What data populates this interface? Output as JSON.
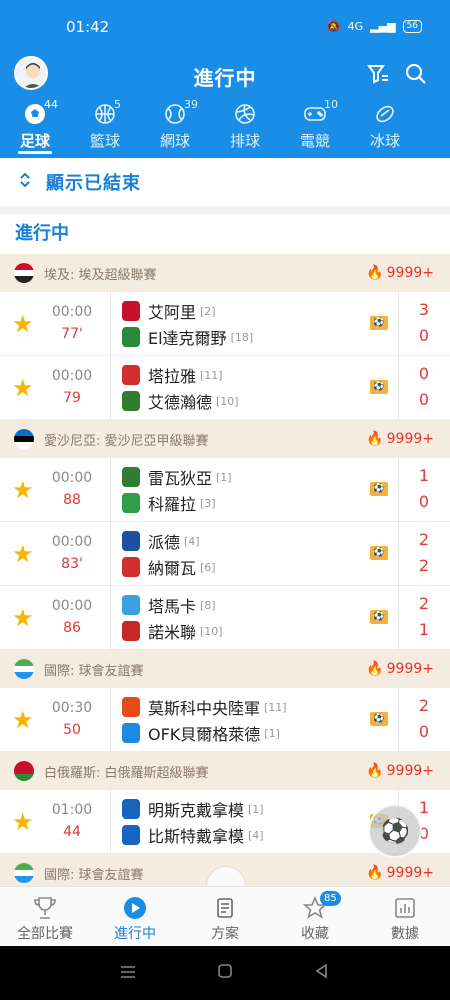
{
  "status_bar": {
    "time": "01:42",
    "network": "4G",
    "battery": "56"
  },
  "header": {
    "title": "進行中"
  },
  "tabs": [
    {
      "label": "足球",
      "count": "44",
      "icon": "soccer-ball-icon",
      "active": true
    },
    {
      "label": "籃球",
      "count": "5",
      "icon": "basketball-icon"
    },
    {
      "label": "網球",
      "count": "39",
      "icon": "tennis-icon"
    },
    {
      "label": "排球",
      "count": "",
      "icon": "volleyball-icon"
    },
    {
      "label": "電競",
      "count": "10",
      "icon": "gamepad-icon"
    },
    {
      "label": "冰球",
      "count": "",
      "icon": "hockey-puck-icon"
    }
  ],
  "show_finished_label": "顯示已結束",
  "section_label": "進行中",
  "leagues": [
    {
      "name": "埃及: 埃及超級聯賽",
      "heat": "9999+",
      "flag": [
        "#ce1126",
        "#ffffff",
        "#222222"
      ],
      "matches": [
        {
          "time": "00:00",
          "minute": "77'",
          "home": "艾阿里",
          "home_rank": "[2]",
          "away": "El達克爾野",
          "away_rank": "[18]",
          "home_score": "3",
          "away_score": "0",
          "home_color": "#c8102e",
          "away_color": "#2a8a3a"
        },
        {
          "time": "00:00",
          "minute": "79",
          "home": "塔拉雅",
          "home_rank": "[11]",
          "away": "艾德瀚德",
          "away_rank": "[10]",
          "home_score": "0",
          "away_score": "0",
          "home_color": "#d32f2f",
          "away_color": "#2e7d32"
        }
      ]
    },
    {
      "name": "愛沙尼亞: 愛沙尼亞甲級聯賽",
      "heat": "9999+",
      "flag": [
        "#0072ce",
        "#000000",
        "#ffffff"
      ],
      "matches": [
        {
          "time": "00:00",
          "minute": "88",
          "home": "雷瓦狄亞",
          "home_rank": "[1]",
          "away": "科羅拉",
          "away_rank": "[3]",
          "home_score": "1",
          "away_score": "0",
          "home_color": "#2e7d32",
          "away_color": "#2e9e4a"
        },
        {
          "time": "00:00",
          "minute": "83'",
          "home": "派德",
          "home_rank": "[4]",
          "away": "納爾瓦",
          "away_rank": "[6]",
          "home_score": "2",
          "away_score": "2",
          "home_color": "#1e4fa0",
          "away_color": "#d32f2f"
        },
        {
          "time": "00:00",
          "minute": "86",
          "home": "塔馬卡",
          "home_rank": "[8]",
          "away": "諾米聯",
          "away_rank": "[10]",
          "home_score": "2",
          "away_score": "1",
          "home_color": "#3aa0e0",
          "away_color": "#c62828"
        }
      ]
    },
    {
      "name": "國際: 球會友誼賽",
      "heat": "9999+",
      "flag": [
        "#4caf50",
        "#ffffff",
        "#2196f3"
      ],
      "matches": [
        {
          "time": "00:30",
          "minute": "50",
          "home": "莫斯科中央陸軍",
          "home_rank": "[11]",
          "away": "OFK貝爾格萊德",
          "away_rank": "[1]",
          "home_score": "2",
          "away_score": "0",
          "home_color": "#e64a19",
          "away_color": "#1e88e5"
        }
      ]
    },
    {
      "name": "白俄羅斯: 白俄羅斯超級聯賽",
      "heat": "9999+",
      "flag": [
        "#c8102e",
        "#c8102e",
        "#2e8b3a"
      ],
      "matches": [
        {
          "time": "01:00",
          "minute": "44",
          "home": "明斯克戴拿模",
          "home_rank": "[1]",
          "away": "比斯特戴拿模",
          "away_rank": "[4]",
          "home_score": "1",
          "away_score": "0",
          "home_color": "#1565c0",
          "away_color": "#1565c0"
        }
      ]
    },
    {
      "name": "國際: 球會友誼賽",
      "heat": "9999+",
      "flag": [
        "#4caf50",
        "#ffffff",
        "#2196f3"
      ],
      "matches": []
    }
  ],
  "bottom_nav": [
    {
      "label": "全部比賽",
      "icon": "trophy-icon"
    },
    {
      "label": "進行中",
      "icon": "play-circle-icon",
      "active": true
    },
    {
      "label": "方案",
      "icon": "document-icon"
    },
    {
      "label": "收藏",
      "icon": "star-outline-icon",
      "badge": "85"
    },
    {
      "label": "數據",
      "icon": "bar-chart-icon"
    }
  ],
  "colors": {
    "primary": "#1a8ee6",
    "live_red": "#e03a3a",
    "star": "#f5b400"
  }
}
